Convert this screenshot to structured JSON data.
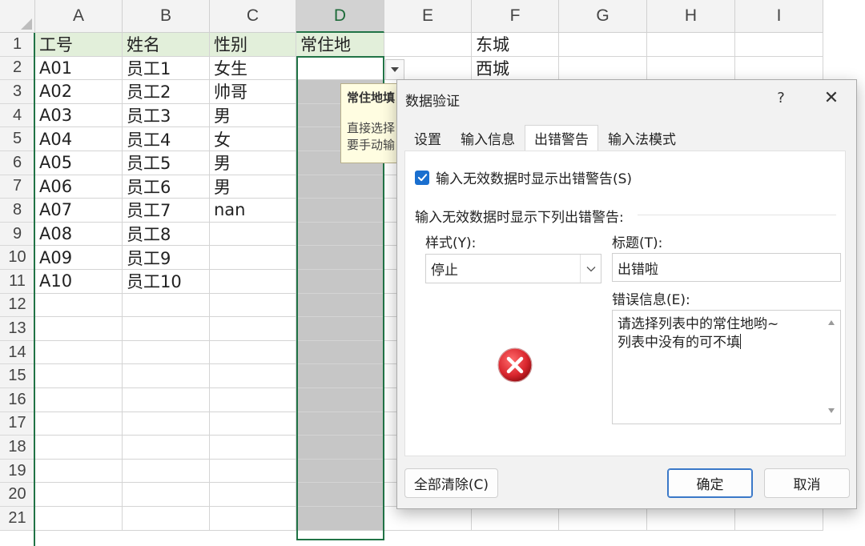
{
  "columns": [
    "A",
    "B",
    "C",
    "D",
    "E",
    "F",
    "G",
    "H",
    "I"
  ],
  "row_numbers": [
    "1",
    "2",
    "3",
    "4",
    "5",
    "6",
    "7",
    "8",
    "9",
    "10",
    "11",
    "12",
    "13",
    "14",
    "15",
    "16",
    "17",
    "18",
    "19",
    "20",
    "21"
  ],
  "cells": {
    "header": [
      "工号",
      "姓名",
      "性别",
      "常住地"
    ],
    "rows": [
      [
        "A01",
        "员工1",
        "女生"
      ],
      [
        "A02",
        "员工2",
        "帅哥"
      ],
      [
        "A03",
        "员工3",
        "男"
      ],
      [
        "A04",
        "员工4",
        "女"
      ],
      [
        "A05",
        "员工5",
        "男"
      ],
      [
        "A06",
        "员工6",
        "男"
      ],
      [
        "A07",
        "员工7",
        "nan"
      ],
      [
        "A08",
        "员工8",
        ""
      ],
      [
        "A09",
        "员工9",
        ""
      ],
      [
        "A10",
        "员工10",
        ""
      ]
    ],
    "f_column": [
      "东城",
      "西城"
    ]
  },
  "tooltip": {
    "title": "常住地填",
    "line1": "直接选择",
    "line2": "要手动输"
  },
  "dialog": {
    "title": "数据验证",
    "help": "?",
    "close": "✕",
    "tabs": [
      "设置",
      "输入信息",
      "出错警告",
      "输入法模式"
    ],
    "active_tab": "出错警告",
    "checkbox_label": "输入无效数据时显示出错警告(S)",
    "checkbox_checked": true,
    "group_label": "输入无效数据时显示下列出错警告:",
    "style_label": "样式(Y):",
    "style_value": "停止",
    "title_label": "标题(T):",
    "title_value": "出错啦",
    "message_label": "错误信息(E):",
    "message_line1": "请选择列表中的常住地哟~",
    "message_line2": "列表中没有的可不填",
    "clear_all": "全部清除(C)",
    "ok": "确定",
    "cancel": "取消"
  },
  "colors": {
    "accent_green": "#217346",
    "header_fill": "#e2efda",
    "selected_column_fill": "#c6c6c6",
    "checkbox_blue": "#1a6fcf",
    "error_red": "#d9262e"
  }
}
